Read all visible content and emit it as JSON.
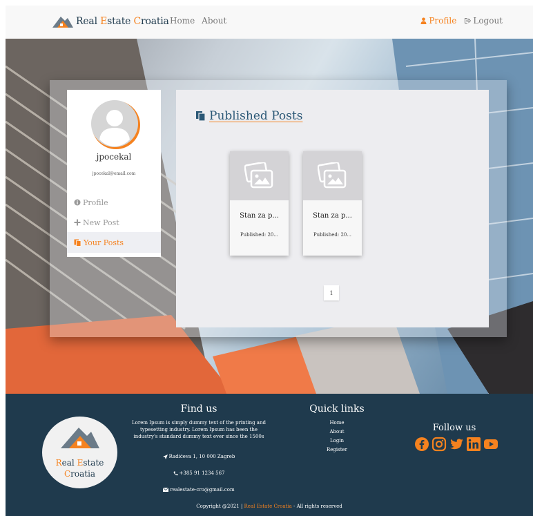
{
  "navbar": {
    "brand_part1": "Real ",
    "brand_part2": "E",
    "brand_part3": "state ",
    "brand_part4": "C",
    "brand_part5": "roatia",
    "home": "Home",
    "about": "About",
    "profile": "Profile",
    "logout": "Logout"
  },
  "sidebar": {
    "username": "jpocekal",
    "email": "jpocekal@email.com",
    "items": [
      {
        "label": "Profile",
        "icon": "info-circle-icon"
      },
      {
        "label": "New Post",
        "icon": "plus-icon"
      },
      {
        "label": "Your Posts",
        "icon": "copy-icon"
      }
    ]
  },
  "main": {
    "title": "Published Posts",
    "cards": [
      {
        "title": "Stan za p...",
        "date": "Published: 20..."
      },
      {
        "title": "Stan za p...",
        "date": "Published: 20..."
      }
    ],
    "page": "1"
  },
  "footer": {
    "logo_line1_a": "R",
    "logo_line1_b": "eal ",
    "logo_line1_c": "E",
    "logo_line1_d": "state",
    "logo_line2_a": "C",
    "logo_line2_b": "roatia",
    "find_title": "Find us",
    "find_desc": "Lorem Ipsum is simply dummy text of the printing and typesetting industry. Lorem Ipsum has been the industry's standard dummy text ever since the 1500s",
    "address": "Radićeva 1, 10 000 Zagreb",
    "phone": "+385 91 1234 567",
    "email": "realestate-cro@gmail.com",
    "quick_title": "Quick links",
    "quick_links": [
      "Home",
      "About",
      "Login",
      "Register"
    ],
    "follow_title": "Follow us",
    "copyright_a": "Copyright @2021 | ",
    "copyright_b": "Real Estate Croatia",
    "copyright_c": " - All rights reserved"
  },
  "colors": {
    "accent": "#f5821f",
    "footer_bg": "#1f3a4d",
    "title_blue": "#2b5876"
  }
}
